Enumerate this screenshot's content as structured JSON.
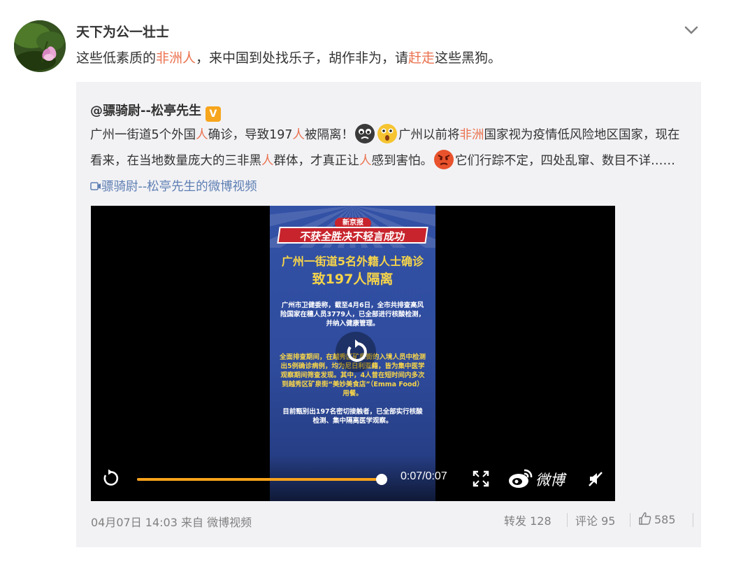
{
  "post": {
    "author": "天下为公一壮士",
    "text_parts": [
      "这些低素质的",
      "非洲人",
      "，来中国到处找乐子，胡作非为，请",
      "赶走",
      "这些黑狗。"
    ]
  },
  "repost": {
    "author": "@骠骑尉--松亭先生",
    "verified_badge": "V",
    "text_parts": [
      "广州一街道5个外国",
      "人",
      "确诊，导致197",
      "人",
      "被隔离！",
      "广州以前将",
      "非洲",
      "国家视为疫情低风险地区国家，现在看来，在当地数量庞大的三非黑",
      "人",
      "群体，才真正让",
      "人",
      "感到害怕。",
      "它们行踪不定，四处乱窜、数目不详……",
      "骠骑尉--松亭先生的微博视频"
    ],
    "emoticons": [
      "sad-emoticon",
      "shocked-emoticon",
      "angry-emoticon"
    ]
  },
  "video": {
    "poster": {
      "logo": "新京报",
      "banner": "不获全胜决不轻言成功",
      "headline1": "广州一街道5名外籍人士确诊",
      "headline2": "致197人隔离",
      "para1": "广州市卫健委称，截至4月6日，全市共排查高风险国家在穗人员3779人，已全部进行核酸检测，并纳入健康管理。",
      "para2": "全面排查期间，在越秀区矿泉街的入境人员中检测出5例确诊病例，均为尼日利亚籍，皆为集中医学观察期间筛查发现。其中，4人曾在短时间内多次到越秀区矿泉街“美妙美食店”（Emma Food）用餐。",
      "para3": "目前甄别出197名密切接触者，已全部实行核酸检测、集中隔离医学观察。"
    },
    "time": "0:07/0:07",
    "progress": 1.0,
    "brand": "微博"
  },
  "footer": {
    "date_source": "04月07日 14:03 来自 微博视频",
    "repost": "转发 128",
    "comment": "评论 95",
    "like_count": "585"
  },
  "colors": {
    "highlight": "#eb7350",
    "link": "#5d7eb2",
    "card_bg": "#f2f2f5",
    "progress": "#f7a21b"
  }
}
